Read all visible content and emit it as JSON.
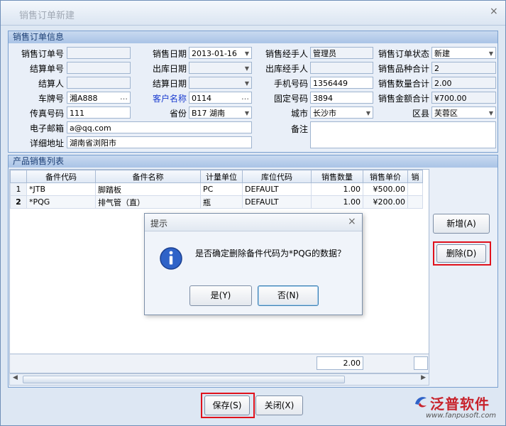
{
  "window": {
    "title": "销售订单新建",
    "close_glyph": "×"
  },
  "order_info": {
    "header": "销售订单信息",
    "order_no_label": "销售订单号",
    "order_no": "",
    "sale_date_label": "销售日期",
    "sale_date": "2013-01-16",
    "sales_manager_label": "销售经手人",
    "sales_manager": "管理员",
    "order_status_label": "销售订单状态",
    "order_status": "新建",
    "settle_no_label": "结算单号",
    "settle_no": "",
    "out_date_label": "出库日期",
    "out_date": "",
    "out_handler_label": "出库经手人",
    "out_handler": "",
    "kinds_total_label": "销售品种合计",
    "kinds_total": "2",
    "settler_label": "结算人",
    "settler": "",
    "settle_date_label": "结算日期",
    "settle_date": "",
    "mobile_label": "手机号码",
    "mobile": "1356449",
    "qty_total_label": "销售数量合计",
    "qty_total": "2.00",
    "plate_label": "车牌号",
    "plate": "湘A888",
    "customer_label": "客户名称",
    "customer": "0114",
    "phone_label": "固定号码",
    "phone": "3894",
    "amount_total_label": "销售金额合计",
    "amount_total": "¥700.00",
    "fax_label": "传真号码",
    "fax": "111",
    "province_label": "省份",
    "province": "B17 湖南",
    "city_label": "城市",
    "city": "长沙市",
    "district_label": "区县",
    "district": "芙蓉区",
    "email_label": "电子邮箱",
    "email": "a@qq.com",
    "remark_label": "备注",
    "remark": "",
    "address_label": "详细地址",
    "address": "湖南省浏阳市"
  },
  "product_list": {
    "header": "产品销售列表",
    "columns": [
      "",
      "备件代码",
      "备件名称",
      "计量单位",
      "库位代码",
      "销售数量",
      "销售单价",
      "销"
    ],
    "rows": [
      {
        "idx": "1",
        "code": "*JTB",
        "name": "脚踏板",
        "unit": "PC",
        "loc": "DEFAULT",
        "qty": "1.00",
        "price": "¥500.00"
      },
      {
        "idx": "2",
        "code": "*PQG",
        "name": "排气管（直）",
        "unit": "瓶",
        "loc": "DEFAULT",
        "qty": "1.00",
        "price": "¥200.00"
      }
    ],
    "footer_qty": "2.00",
    "add_button": "新增(A)",
    "delete_button": "删除(D)"
  },
  "dialog": {
    "title": "提示",
    "close_glyph": "×",
    "message": "是否确定删除备件代码为*PQG的数据？",
    "yes": "是(Y)",
    "no": "否(N)"
  },
  "bottom": {
    "save": "保存(S)",
    "close": "关闭(X)"
  },
  "watermark": {
    "brand": "泛普软件",
    "url": "www.fanpusoft.com"
  },
  "colors": {
    "highlight_box": "#e0121c",
    "info_icon": "#2f63c8",
    "brand_red": "#c8232c"
  }
}
